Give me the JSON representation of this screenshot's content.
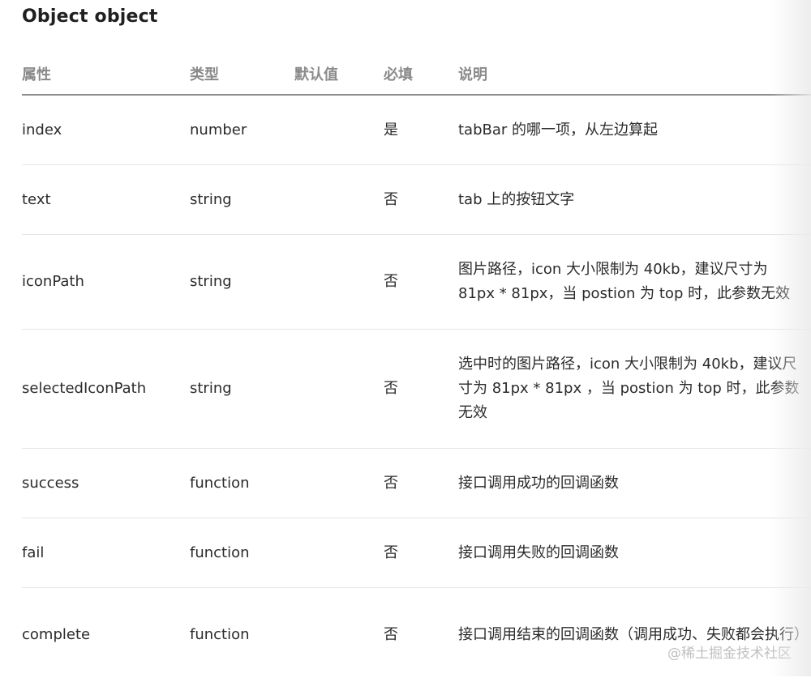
{
  "title": "Object object",
  "table": {
    "headers": {
      "name": "属性",
      "type": "类型",
      "default": "默认值",
      "required": "必填",
      "desc": "说明"
    },
    "rows": [
      {
        "name": "index",
        "type": "number",
        "default": "",
        "required": "是",
        "desc": "tabBar 的哪一项，从左边算起"
      },
      {
        "name": "text",
        "type": "string",
        "default": "",
        "required": "否",
        "desc": "tab 上的按钮文字"
      },
      {
        "name": "iconPath",
        "type": "string",
        "default": "",
        "required": "否",
        "desc": "图片路径，icon 大小限制为 40kb，建议尺寸为 81px * 81px，当 postion 为 top 时，此参数无效"
      },
      {
        "name": "selectedIconPath",
        "type": "string",
        "default": "",
        "required": "否",
        "desc": "选中时的图片路径，icon 大小限制为 40kb，建议尺寸为 81px * 81px ，当 postion 为 top 时，此参数无效"
      },
      {
        "name": "success",
        "type": "function",
        "default": "",
        "required": "否",
        "desc": "接口调用成功的回调函数"
      },
      {
        "name": "fail",
        "type": "function",
        "default": "",
        "required": "否",
        "desc": "接口调用失败的回调函数"
      },
      {
        "name": "complete",
        "type": "function",
        "default": "",
        "required": "否",
        "desc": "接口调用结束的回调函数（调用成功、失败都会执行）"
      }
    ]
  },
  "watermark": "@稀土掘金技术社区"
}
